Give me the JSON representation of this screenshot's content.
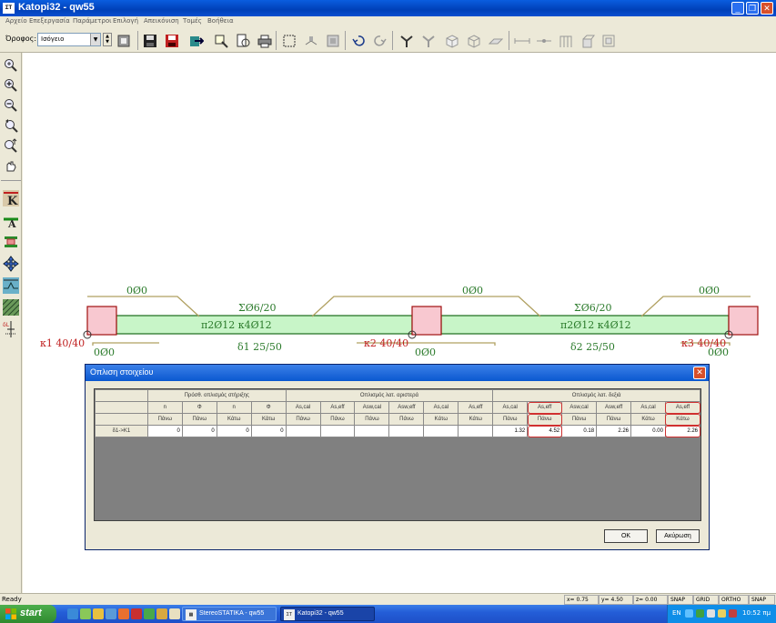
{
  "window": {
    "title": "Katopi32 - qw55",
    "app_icon": "ΣΤ",
    "minimize_icon": "_",
    "restore_icon": "❐",
    "close_icon": "✕"
  },
  "menu": [
    "Αρχείο",
    "Επεξεργασία",
    "Παράμετροι",
    "Επιλογή",
    "Απεικόνιση",
    "Τομές",
    "Βοήθεια"
  ],
  "toolbar": {
    "floor_label": "Όροφος:",
    "floor_value": "Ισόγειο",
    "icons": [
      "stop-icon",
      "save-icon",
      "save-as-icon",
      "export-icon",
      "zoom-window-icon",
      "magnify-page-icon",
      "print-icon",
      "select-frame-icon",
      "column-icon",
      "wall-icon",
      "undo-icon",
      "redo-icon",
      "beam-icon",
      "beam-3d-icon",
      "cube-icon",
      "cube-outline-icon",
      "slab-icon",
      "dimension-line-icon",
      "dimension-node-icon",
      "frame-icon",
      "section-icon",
      "section-3d-icon"
    ]
  },
  "left_toolbar": {
    "icons": [
      "zoom-extents-icon",
      "zoom-in-icon",
      "zoom-out-icon",
      "zoom-previous-icon",
      "zoom-realtime-icon",
      "pan-icon",
      "column-reinforcement-icon",
      "beam-reinforcement-icon",
      "beam-section-icon",
      "move-icon",
      "stirrup-icon",
      "slab-hatch-icon",
      "dimension-icon"
    ]
  },
  "drawing": {
    "beam_color": "#c8f5c8",
    "column_color": "#f8c8d0",
    "columns": [
      "κ1 40/40",
      "κ2 40/40",
      "κ3 40/40"
    ],
    "beams": [
      "δ1 25/50",
      "δ2 25/50"
    ],
    "bars": {
      "top_left": "0Ø0",
      "top_middle": "0Ø0",
      "top_right": "0Ø0",
      "bottom_left": "0Ø0",
      "bottom_middle": "0Ø0",
      "bottom_right": "0Ø0",
      "stirrups_1": "ΣØ6/20",
      "stirrups_2": "ΣØ6/20",
      "main_1": "π2Ø12 κ4Ø12",
      "main_2": "π2Ø12 κ4Ø12"
    }
  },
  "dialog": {
    "title": "Οπλιση στοιχείου",
    "close_icon": "✕",
    "groups": [
      "Πρόσθ. οπλισμός στήριξης",
      "Οπλισμός λατ. αριστερά",
      "Οπλισμός λατ. δεξιά"
    ],
    "columns": [
      {
        "top": "n",
        "bottom": "Πάνω"
      },
      {
        "top": "Φ",
        "bottom": "Πάνω"
      },
      {
        "top": "n",
        "bottom": "Κάτω"
      },
      {
        "top": "Φ",
        "bottom": "Κάτω"
      },
      {
        "top": "As,cal",
        "bottom": "Πάνω"
      },
      {
        "top": "As,eff",
        "bottom": "Πάνω"
      },
      {
        "top": "Asw,cal",
        "bottom": "Πάνω"
      },
      {
        "top": "Asw,eff",
        "bottom": "Πάνω"
      },
      {
        "top": "As,cal",
        "bottom": "Κάτω"
      },
      {
        "top": "As,eff",
        "bottom": "Κάτω"
      },
      {
        "top": "As,cal",
        "bottom": "Πάνω"
      },
      {
        "top": "As,eff",
        "bottom": "Πάνω"
      },
      {
        "top": "Asw,cal",
        "bottom": "Πάνω"
      },
      {
        "top": "Asw,eff",
        "bottom": "Πάνω"
      },
      {
        "top": "As,cal",
        "bottom": "Κάτω"
      },
      {
        "top": "As,eff",
        "bottom": "Κάτω"
      }
    ],
    "rows": [
      {
        "label": "δ1->Κ1",
        "values": [
          "0",
          "0",
          "0",
          "0",
          "",
          "",
          "",
          "",
          "",
          "",
          "1.32",
          "4.52",
          "0.18",
          "2.26",
          "0.00",
          "2.26"
        ]
      }
    ],
    "ok_label": "OK",
    "cancel_label": "Ακύρωση"
  },
  "statusbar": {
    "ready": "Ready",
    "x": "x=  0.75",
    "y": "y=  4.50",
    "z": "z=  0.00",
    "snap": "SNAP",
    "grid": "GRID",
    "ortho": "ORTHO",
    "osnap": "SNAP"
  },
  "taskbar": {
    "start_label": "start",
    "tasks": [
      "StereoSTATIKA - qw55",
      "Katopi32 - qw55"
    ],
    "language": "EN",
    "clock": "10:52 πμ"
  }
}
